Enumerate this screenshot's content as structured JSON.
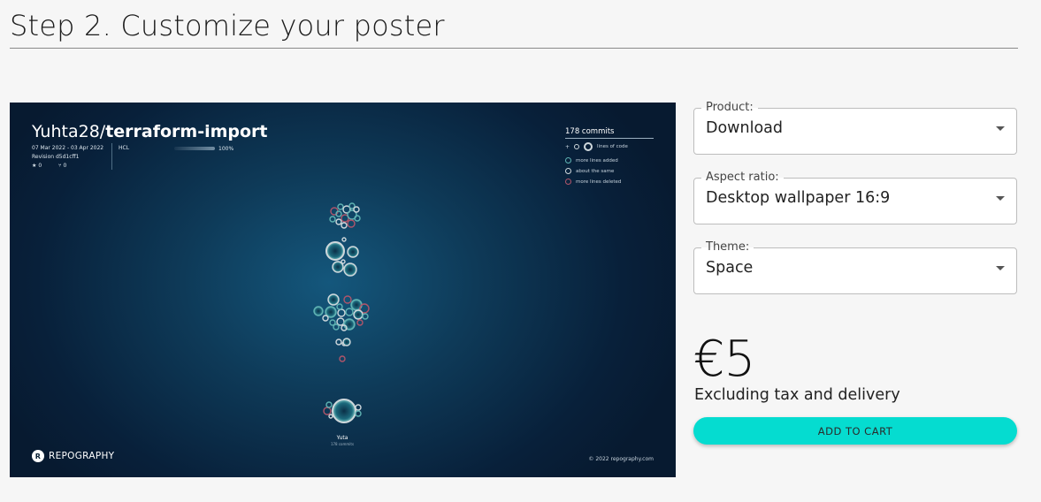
{
  "page": {
    "heading": "Step 2. Customize your poster"
  },
  "poster": {
    "owner": "Yuhta28/",
    "repo": "terraform-import",
    "date_range": "07 Mar 2022 - 03 Apr 2022",
    "revision": "Revision d5d1cff1",
    "stars": "0",
    "forks": "0",
    "language": "HCL",
    "language_percent": "100%",
    "legend": {
      "commits": "178 commits",
      "lines_of_code": "lines of code",
      "added": "more lines added",
      "same": "about the same",
      "deleted": "more lines deleted"
    },
    "author_name": "Yuta",
    "author_commits": "178 commits",
    "brand": "REPOGRAPHY",
    "copyright": "© 2022 repography.com",
    "colors": {
      "added": "#5fb3b3",
      "same": "#cfd8dc",
      "deleted": "#b0556a"
    }
  },
  "form": {
    "product": {
      "label": "Product:",
      "value": "Download"
    },
    "aspect": {
      "label": "Aspect ratio:",
      "value": "Desktop wallpaper 16:9"
    },
    "theme": {
      "label": "Theme:",
      "value": "Space"
    }
  },
  "price": {
    "amount": "€5",
    "note": "Excluding tax and delivery"
  },
  "cart_button": "ADD TO CART",
  "accent_color": "#05dcd0"
}
